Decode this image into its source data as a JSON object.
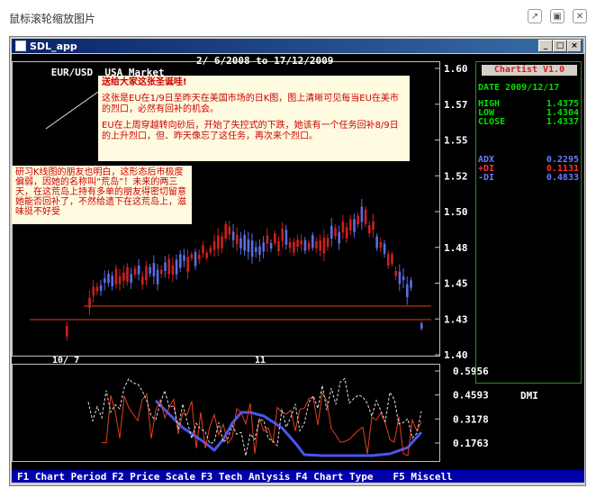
{
  "viewer": {
    "title": "鼠标滚轮缩放图片",
    "buttons": {
      "external": "↗",
      "fit": "▣",
      "close": "✕"
    }
  },
  "app": {
    "title": "SDL_app",
    "buttons": {
      "minimize": "_",
      "maximize": "□",
      "close": "×"
    }
  },
  "header": {
    "symbol": "EUR/USD",
    "market": "USA Market",
    "date_range": "2/ 6/2008 to 17/12/2009"
  },
  "notes": {
    "top": [
      "送给大家这张圣诞哇!",
      "这张是EU在1/9日至昨天在美国市场的日K图，图上清晰可见每当EU在美市的烈口，必然有回补的机会。",
      "EU在上周穿越转向砂后，开始了失控式的下跌，她该有一个任务回补8/9日的上升烈口，但、昨天像忘了这任务，再次来个烈口。"
    ],
    "left": "研习K线图的朋友也明白，这形态后市极度偏弱，因她的名称叫“荒岛”！未来的两三天，在这荒岛上持有多单的朋友得密切留意她能否回补了，不然给遗下在这荒岛上，滋味挺不好受"
  },
  "price_axis": [
    "1.60",
    "1.57",
    "1.55",
    "1.52",
    "1.50",
    "1.48",
    "1.45",
    "1.43",
    "1.40"
  ],
  "x_axis": {
    "left": "10/ 7",
    "mid": "11"
  },
  "ind_axis": [
    "0.5956",
    "0.4593",
    "0.3178",
    "0.1763"
  ],
  "ind_label": "DMI",
  "panel": {
    "brand": "Chartist V1.0",
    "date_label": "DATE",
    "date": "2009/12/17",
    "rows": [
      {
        "label": "HIGH",
        "value": "1.4375"
      },
      {
        "label": "LOW",
        "value": "1.4304"
      },
      {
        "label": "CLOSE",
        "value": "1.4337"
      }
    ],
    "ind": [
      {
        "label": "ADX",
        "value": "0.2295"
      },
      {
        "label": "+DI",
        "value": "0.1131"
      },
      {
        "label": "-DI",
        "value": "0.4833"
      }
    ]
  },
  "fkeys": [
    "F1 Chart Period",
    "F2 Price Scale",
    "F3 Tech Anlysis",
    "F4 Chart Type",
    "F5 Miscell"
  ],
  "colors": {
    "up": "#5a6ee0",
    "down": "#cc2020",
    "adx": "#4a55f0",
    "pdi": "#e04020",
    "mdi": "#e0e0e0"
  }
}
